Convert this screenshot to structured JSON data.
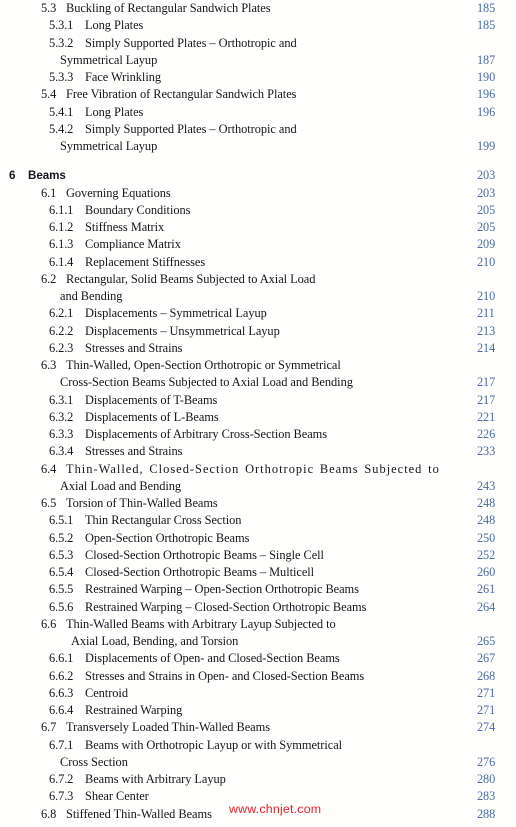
{
  "document": {
    "type": "table-of-contents",
    "page_number_color": "#4a6ba4",
    "text_color": "#14161c",
    "background_color": "#fffffe"
  },
  "watermark": {
    "text": "www.chnjet.com",
    "color": "#e8202a"
  },
  "entries": [
    {
      "id": "e0",
      "level": "2",
      "num": "5.3",
      "title": "Buckling of Rectangular Sandwich Plates",
      "page": "185"
    },
    {
      "id": "e1",
      "level": "3",
      "num": "5.3.1",
      "title": "Long Plates",
      "page": "185"
    },
    {
      "id": "e2",
      "level": "3",
      "num": "5.3.2",
      "title": "Simply Supported Plates – Orthotropic and",
      "page": ""
    },
    {
      "id": "e3",
      "level": "cont",
      "num": "",
      "title": "Symmetrical Layup",
      "page": "187"
    },
    {
      "id": "e4",
      "level": "3",
      "num": "5.3.3",
      "title": "Face Wrinkling",
      "page": "190"
    },
    {
      "id": "e5",
      "level": "2",
      "num": "5.4",
      "title": "Free Vibration of Rectangular Sandwich Plates",
      "page": "196"
    },
    {
      "id": "e6",
      "level": "3",
      "num": "5.4.1",
      "title": "Long Plates",
      "page": "196"
    },
    {
      "id": "e7",
      "level": "3",
      "num": "5.4.2",
      "title": "Simply Supported Plates – Orthotropic and",
      "page": ""
    },
    {
      "id": "e8",
      "level": "cont",
      "num": "",
      "title": "Symmetrical Layup",
      "page": "199"
    },
    {
      "id": "e9",
      "level": "spacer",
      "num": "",
      "title": "",
      "page": ""
    },
    {
      "id": "e10",
      "level": "chapter",
      "num": "6",
      "title": "Beams",
      "page": "203"
    },
    {
      "id": "e11",
      "level": "2",
      "num": "6.1",
      "title": "Governing Equations",
      "page": "203"
    },
    {
      "id": "e12",
      "level": "3",
      "num": "6.1.1",
      "title": "Boundary Conditions",
      "page": "205"
    },
    {
      "id": "e13",
      "level": "3",
      "num": "6.1.2",
      "title": "Stiffness Matrix",
      "page": "205"
    },
    {
      "id": "e14",
      "level": "3",
      "num": "6.1.3",
      "title": "Compliance Matrix",
      "page": "209"
    },
    {
      "id": "e15",
      "level": "3",
      "num": "6.1.4",
      "title": "Replacement Stiffnesses",
      "page": "210"
    },
    {
      "id": "e16",
      "level": "2",
      "num": "6.2",
      "title": "Rectangular, Solid Beams Subjected to Axial Load",
      "page": ""
    },
    {
      "id": "e17",
      "level": "cont",
      "num": "",
      "title": "and Bending",
      "page": "210"
    },
    {
      "id": "e18",
      "level": "3",
      "num": "6.2.1",
      "title": "Displacements – Symmetrical Layup",
      "page": "211"
    },
    {
      "id": "e19",
      "level": "3",
      "num": "6.2.2",
      "title": "Displacements – Unsymmetrical Layup",
      "page": "213"
    },
    {
      "id": "e20",
      "level": "3",
      "num": "6.2.3",
      "title": "Stresses and Strains",
      "page": "214"
    },
    {
      "id": "e21",
      "level": "2",
      "num": "6.3",
      "title": "Thin-Walled, Open-Section Orthotropic or Symmetrical",
      "page": ""
    },
    {
      "id": "e22",
      "level": "cont",
      "num": "",
      "title": "Cross-Section Beams Subjected to Axial Load and Bending",
      "page": "217"
    },
    {
      "id": "e23",
      "level": "3",
      "num": "6.3.1",
      "title": "Displacements of T-Beams",
      "page": "217"
    },
    {
      "id": "e24",
      "level": "3",
      "num": "6.3.2",
      "title": "Displacements of L-Beams",
      "page": "221"
    },
    {
      "id": "e25",
      "level": "3",
      "num": "6.3.3",
      "title": "Displacements of Arbitrary Cross-Section Beams",
      "page": "226"
    },
    {
      "id": "e26",
      "level": "3",
      "num": "6.3.4",
      "title": "Stresses and Strains",
      "page": "233"
    },
    {
      "id": "e27",
      "level": "2-just",
      "num": "6.4",
      "title": "Thin-Walled, Closed-Section Orthotropic Beams Subjected to",
      "page": ""
    },
    {
      "id": "e28",
      "level": "cont",
      "num": "",
      "title": "Axial Load and Bending",
      "page": "243"
    },
    {
      "id": "e29",
      "level": "2",
      "num": "6.5",
      "title": "Torsion of Thin-Walled Beams",
      "page": "248"
    },
    {
      "id": "e30",
      "level": "3",
      "num": "6.5.1",
      "title": "Thin Rectangular Cross Section",
      "page": "248"
    },
    {
      "id": "e31",
      "level": "3",
      "num": "6.5.2",
      "title": "Open-Section Orthotropic Beams",
      "page": "250"
    },
    {
      "id": "e32",
      "level": "3",
      "num": "6.5.3",
      "title": "Closed-Section Orthotropic Beams – Single Cell",
      "page": "252"
    },
    {
      "id": "e33",
      "level": "3",
      "num": "6.5.4",
      "title": "Closed-Section Orthotropic Beams – Multicell",
      "page": "260"
    },
    {
      "id": "e34",
      "level": "3",
      "num": "6.5.5",
      "title": "Restrained Warping – Open-Section Orthotropic Beams",
      "page": "261"
    },
    {
      "id": "e35",
      "level": "3",
      "num": "6.5.6",
      "title": "Restrained Warping – Closed-Section Orthotropic Beams",
      "page": "264"
    },
    {
      "id": "e36",
      "level": "2",
      "num": "6.6",
      "title": "Thin-Walled Beams with Arbitrary Layup Subjected to",
      "page": ""
    },
    {
      "id": "e37",
      "level": "cont-deep",
      "num": "",
      "title": "Axial Load, Bending, and Torsion",
      "page": "265"
    },
    {
      "id": "e38",
      "level": "3",
      "num": "6.6.1",
      "title": "Displacements of Open- and Closed-Section Beams",
      "page": "267"
    },
    {
      "id": "e39",
      "level": "3",
      "num": "6.6.2",
      "title": "Stresses and Strains in Open- and Closed-Section Beams",
      "page": "268"
    },
    {
      "id": "e40",
      "level": "3",
      "num": "6.6.3",
      "title": "Centroid",
      "page": "271"
    },
    {
      "id": "e41",
      "level": "3",
      "num": "6.6.4",
      "title": "Restrained Warping",
      "page": "271"
    },
    {
      "id": "e42",
      "level": "2",
      "num": "6.7",
      "title": "Transversely Loaded Thin-Walled Beams",
      "page": "274"
    },
    {
      "id": "e43",
      "level": "3",
      "num": "6.7.1",
      "title": "Beams with Orthotropic Layup or with Symmetrical",
      "page": ""
    },
    {
      "id": "e44",
      "level": "cont",
      "num": "",
      "title": "Cross Section",
      "page": "276"
    },
    {
      "id": "e45",
      "level": "3",
      "num": "6.7.2",
      "title": "Beams with Arbitrary Layup",
      "page": "280"
    },
    {
      "id": "e46",
      "level": "3",
      "num": "6.7.3",
      "title": "Shear Center",
      "page": "283"
    },
    {
      "id": "e47",
      "level": "2",
      "num": "6.8",
      "title": "Stiffened Thin-Walled Beams",
      "page": "288"
    }
  ]
}
